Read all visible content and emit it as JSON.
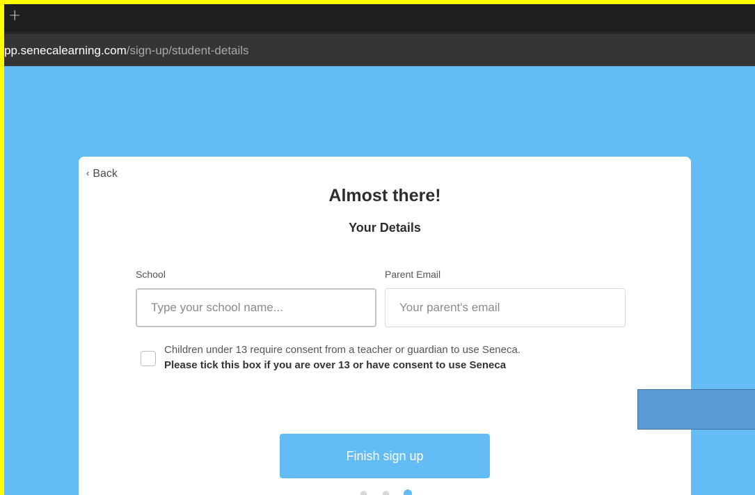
{
  "browser": {
    "new_tab_icon": "plus-icon",
    "url_host": "pp.senecalearning.com",
    "url_path": "/sign-up/student-details"
  },
  "card": {
    "back_label": "Back",
    "title": "Almost there!",
    "subtitle": "Your Details",
    "school_label": "School",
    "school_placeholder": "Type your school name...",
    "email_label": "Parent Email",
    "email_placeholder": "Your parent's email",
    "consent_text": "Children under 13 require consent from a teacher or guardian to use Seneca.",
    "consent_bold": "Please tick this box if you are over 13 or have consent to use Seneca",
    "finish_label": "Finish sign up",
    "progress_step": 3,
    "progress_total": 3
  },
  "colors": {
    "background": "#63bdf4",
    "accent": "#63bdf4",
    "outer_border": "#ffff00",
    "overlay_box": "#5b9bd5"
  }
}
